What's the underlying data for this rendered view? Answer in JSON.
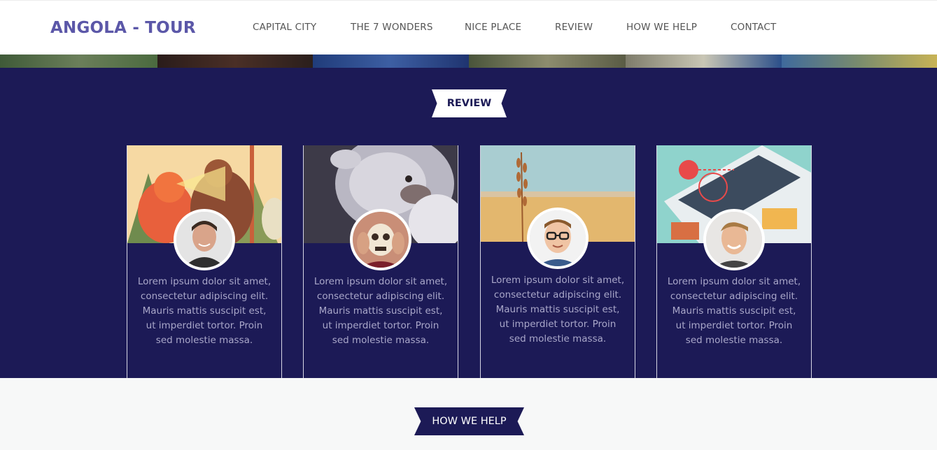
{
  "header": {
    "brand": "ANGOLA - TOUR",
    "nav": [
      {
        "label": "CAPITAL CITY"
      },
      {
        "label": "THE 7 WONDERS"
      },
      {
        "label": "NICE PLACE"
      },
      {
        "label": "REVIEW"
      },
      {
        "label": "HOW WE HELP"
      },
      {
        "label": "CONTACT"
      }
    ]
  },
  "review": {
    "title": "REVIEW",
    "cards": [
      {
        "image_icon": "illustrated-animals-image",
        "avatar_icon": "smiling-man-avatar",
        "text": "Lorem ipsum dolor sit amet, consectetur adipiscing elit. Mauris mattis suscipit est, ut imperdiet tortor. Proin sed molestie massa."
      },
      {
        "image_icon": "polar-bear-image",
        "avatar_icon": "skull-mask-avatar",
        "text": "Lorem ipsum dolor sit amet, consectetur adipiscing elit. Mauris mattis suscipit est, ut imperdiet tortor. Proin sed molestie massa."
      },
      {
        "image_icon": "wheat-field-image",
        "avatar_icon": "man-with-glasses-avatar",
        "text": "Lorem ipsum dolor sit amet, consectetur adipiscing elit. Mauris mattis suscipit est, ut imperdiet tortor. Proin sed molestie massa."
      },
      {
        "image_icon": "smartphone-infographic-image",
        "avatar_icon": "young-man-avatar",
        "text": "Lorem ipsum dolor sit amet, consectetur adipiscing elit. Mauris mattis suscipit est, ut imperdiet tortor. Proin sed molestie massa."
      }
    ]
  },
  "help": {
    "title": "HOW WE HELP"
  },
  "colors": {
    "brand": "#5b57a8",
    "section_bg": "#1c1a56",
    "card_text": "#a9a7c9"
  }
}
